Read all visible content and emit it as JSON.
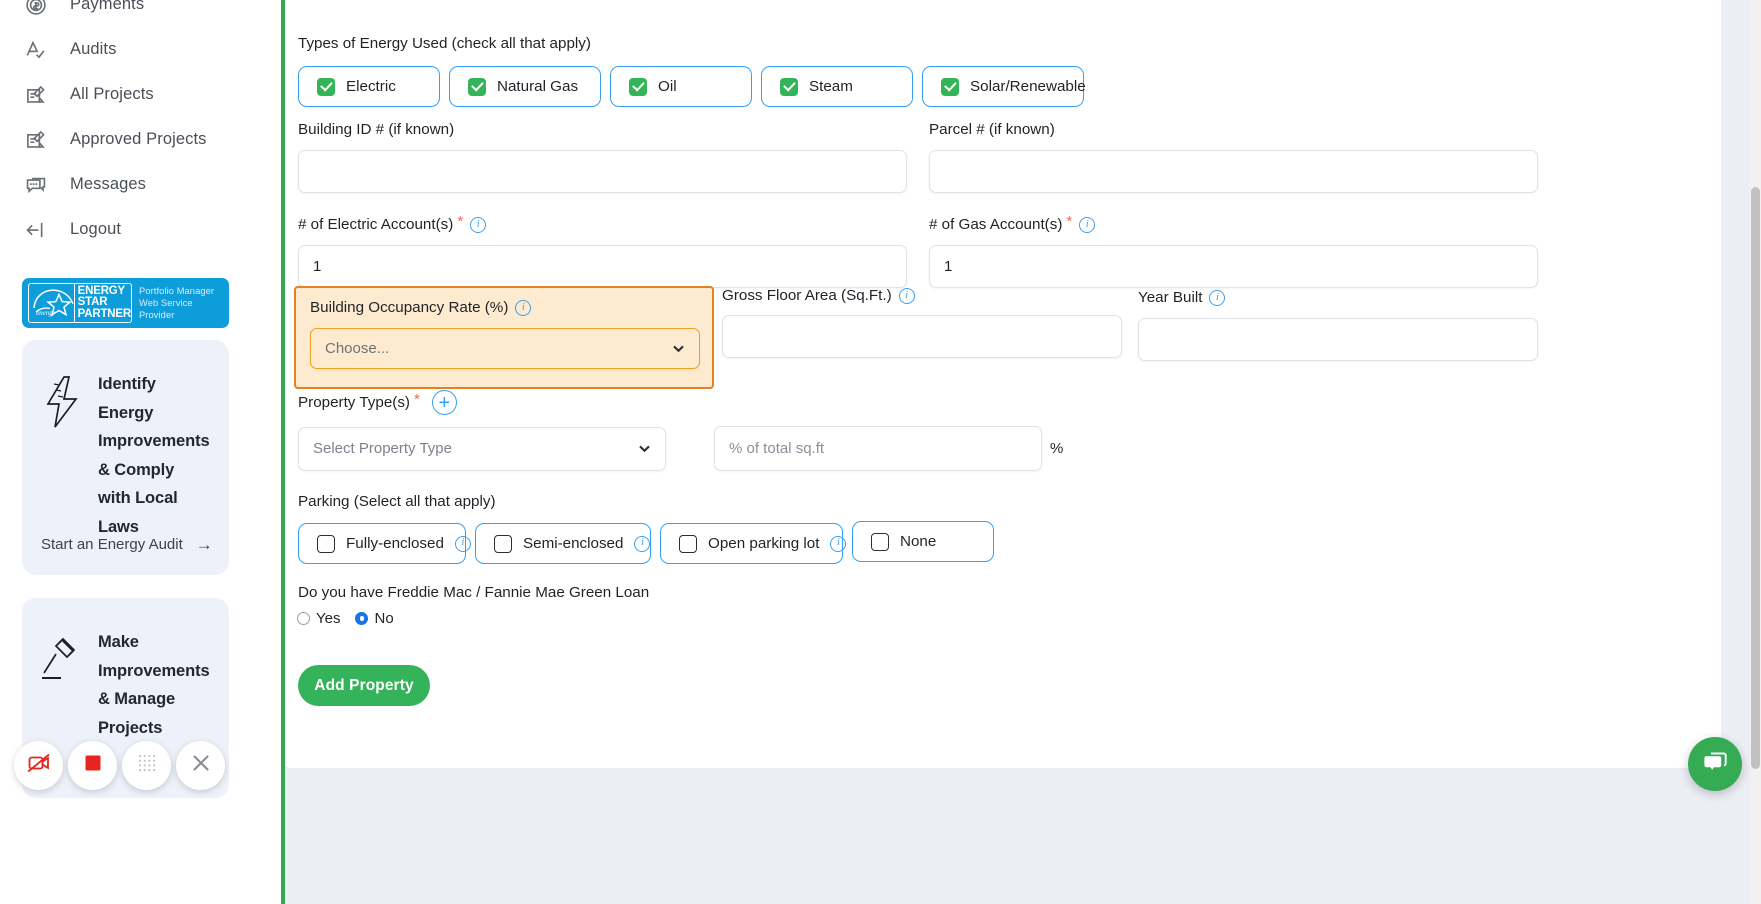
{
  "sidebar": {
    "nav": [
      {
        "label": "Payments",
        "icon": "payments-icon"
      },
      {
        "label": "Audits",
        "icon": "audits-icon"
      },
      {
        "label": "All Projects",
        "icon": "all-projects-icon"
      },
      {
        "label": "Approved Projects",
        "icon": "approved-projects-icon"
      },
      {
        "label": "Messages",
        "icon": "messages-icon"
      },
      {
        "label": "Logout",
        "icon": "logout-icon"
      }
    ],
    "badge": {
      "line1": "ENERGY",
      "line2": "STAR",
      "line3": "PARTNER",
      "tagline1": "Portfolio Manager",
      "tagline2": "Web Service Provider",
      "brand_color": "#0d9ddb"
    },
    "promo_identify": {
      "text": "Identify Energy Improvements & Comply with Local Laws",
      "link": "Start an Energy Audit",
      "arrow": "→",
      "icon": "lightning-bolt-icon"
    },
    "promo_make": {
      "text": "Make Improvements & Manage Projects",
      "icon": "gavel-icon"
    }
  },
  "form": {
    "energy_types": {
      "label": "Types of Energy Used (check all that apply)",
      "options": [
        {
          "label": "Electric",
          "checked": true
        },
        {
          "label": "Natural Gas",
          "checked": true
        },
        {
          "label": "Oil",
          "checked": true
        },
        {
          "label": "Steam",
          "checked": true
        },
        {
          "label": "Solar/Renewable",
          "checked": true
        }
      ]
    },
    "building_id": {
      "label": "Building ID # (if known)",
      "value": "",
      "placeholder": ""
    },
    "parcel": {
      "label": "Parcel # (if known)",
      "value": "",
      "placeholder": ""
    },
    "electric_accounts": {
      "label": "# of Electric Account(s)",
      "required": "*",
      "value": "1",
      "placeholder": ""
    },
    "gas_accounts": {
      "label": "# of Gas Account(s)",
      "required": "*",
      "value": "1",
      "placeholder": ""
    },
    "occupancy": {
      "label": "Building Occupancy Rate (%)",
      "selected": "Choose...",
      "highlight_border": "#e8801d",
      "highlight_fill": "#fdeacf"
    },
    "gross_floor_area": {
      "label": "Gross Floor Area (Sq.Ft.)",
      "value": "",
      "placeholder": ""
    },
    "year_built": {
      "label": "Year Built",
      "value": "",
      "placeholder": ""
    },
    "property_types": {
      "label": "Property Type(s)",
      "required": "*",
      "add_icon": "plus-circle-icon",
      "select_placeholder": "Select Property Type",
      "percent_placeholder": "% of total sq.ft",
      "percent_suffix": "%"
    },
    "parking": {
      "label": "Parking (Select all that apply)",
      "options": [
        {
          "label": "Fully-enclosed",
          "checked": false,
          "has_info": true
        },
        {
          "label": "Semi-enclosed",
          "checked": false,
          "has_info": true
        },
        {
          "label": "Open parking lot",
          "checked": false,
          "has_info": true
        },
        {
          "label": "None",
          "checked": false,
          "has_info": false
        }
      ]
    },
    "green_loan": {
      "label": "Do you have Freddie Mac / Fannie Mae Green Loan",
      "options": [
        {
          "label": "Yes",
          "selected": false
        },
        {
          "label": "No",
          "selected": true
        }
      ]
    },
    "submit_label": "Add Property"
  },
  "overlays": {
    "recorder": [
      {
        "name": "camera-off-icon"
      },
      {
        "name": "stop-recording-icon"
      },
      {
        "name": "grid-dots-icon"
      },
      {
        "name": "close-icon"
      }
    ],
    "chat": {
      "icon": "chat-bubble-icon",
      "color": "#35ab54"
    }
  }
}
